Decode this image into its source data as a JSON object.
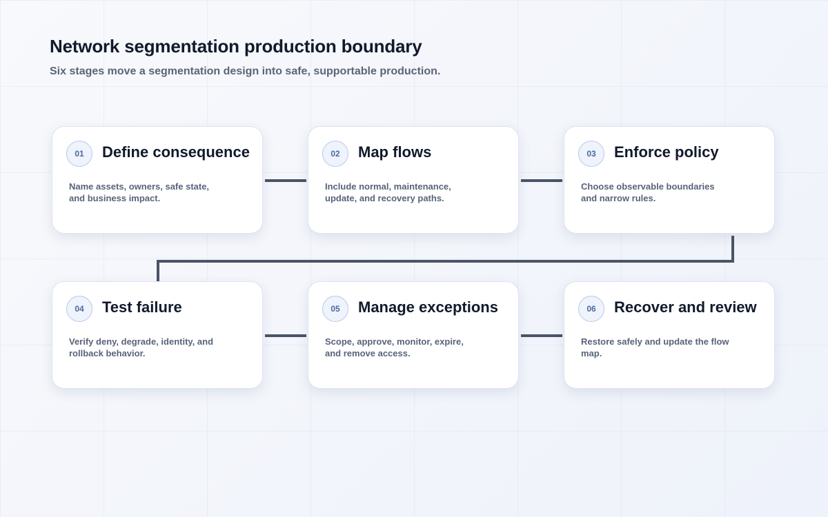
{
  "header": {
    "title": "Network segmentation production boundary",
    "subtitle": "Six stages move a segmentation design into safe, supportable production."
  },
  "stages": [
    {
      "number": "01",
      "title": "Define consequence",
      "description": "Name assets, owners, safe state, and business impact."
    },
    {
      "number": "02",
      "title": "Map flows",
      "description": "Include normal, maintenance, update, and recovery paths."
    },
    {
      "number": "03",
      "title": "Enforce policy",
      "description": "Choose observable boundaries and narrow rules."
    },
    {
      "number": "04",
      "title": "Test failure",
      "description": "Verify deny, degrade, identity, and rollback behavior."
    },
    {
      "number": "05",
      "title": "Manage exceptions",
      "description": "Scope, approve, monitor, expire, and remove access."
    },
    {
      "number": "06",
      "title": "Recover and review",
      "description": "Restore safely and update the flow map."
    }
  ],
  "colors": {
    "connector": "#4a5466",
    "badge_border": "#b7c9ec",
    "badge_text": "#4a6aa5",
    "title_text": "#111a2b"
  }
}
